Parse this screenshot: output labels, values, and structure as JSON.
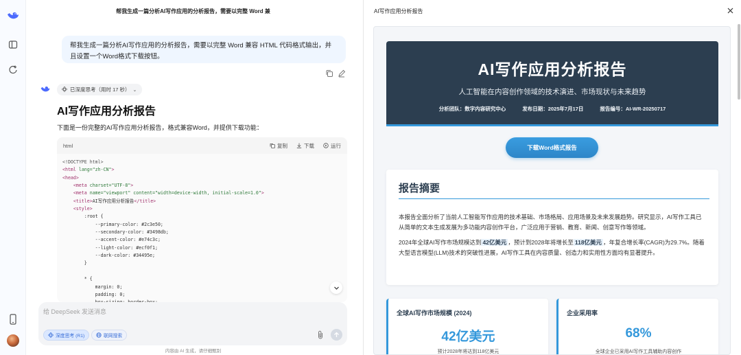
{
  "chat": {
    "title": "帮我生成一篇分析AI写作应用的分析报告，需要以完整 Word 兼",
    "user_message": "帮我生成一篇分析AI写作应用的分析报告，需要以完整 Word 兼容 HTML 代码格式输出，并且设置一个Word格式下载按钮。",
    "think_chip": "已深度思考（用时 17 秒）",
    "answer_heading": "AI写作应用分析报告",
    "answer_intro": "下面是一份完整的AI写作应用分析报告，格式兼容Word，并提供下载功能：",
    "code": {
      "lang": "html",
      "copy_label": "复制",
      "download_label": "下载",
      "run_label": "运行"
    },
    "composer": {
      "placeholder": "给 DeepSeek 发送消息",
      "deep_think": "深度思考 (R1)",
      "web_search": "联网搜索"
    },
    "disclaimer": "内容由 AI 生成，请仔细甄别"
  },
  "panel": {
    "title": "AI写作应用分析报告",
    "report": {
      "title": "AI写作应用分析报告",
      "subtitle": "人工智能在内容创作领域的技术演进、市场现状与未来趋势",
      "team": "分析团队：数字内容研究中心",
      "date": "发布日期：2025年7月17日",
      "number": "报告编号：AI-WR-20250717",
      "download_button": "下载Word格式报告",
      "summary_heading": "报告摘要",
      "summary_p1": "本报告全面分析了当前人工智能写作应用的技术基础、市场格局、应用场景及未来发展趋势。研究显示，AI写作工具已从简单的文本生成发展为多功能内容创作平台，广泛应用于营销、教育、新闻、创意写作等领域。",
      "summary_p2_a": "2024年全球AI写作市场规模达到",
      "summary_p2_h1": "42亿美元",
      "summary_p2_b": "，预计到2028年将增长至",
      "summary_p2_h2": "118亿美元",
      "summary_p2_c": "，年复合增长率(CAGR)为29.7%。随着大型语言模型(LLM)技术的突破性进展，AI写作工具在内容质量、创造力和实用性方面均有显著提升。",
      "stats": [
        {
          "title": "全球AI写作市场规模 (2024)",
          "value": "42亿美元",
          "note": "预计2028年将达到118亿美元"
        },
        {
          "title": "企业采用率",
          "value": "68%",
          "note": "全球企业已采用AI写作工具辅助内容创作"
        }
      ]
    }
  },
  "colors": {
    "primary": "#2c3e50",
    "secondary": "#3498db",
    "accent": "#e74c3c",
    "light": "#ecf0f1",
    "dark": "#34495e"
  }
}
